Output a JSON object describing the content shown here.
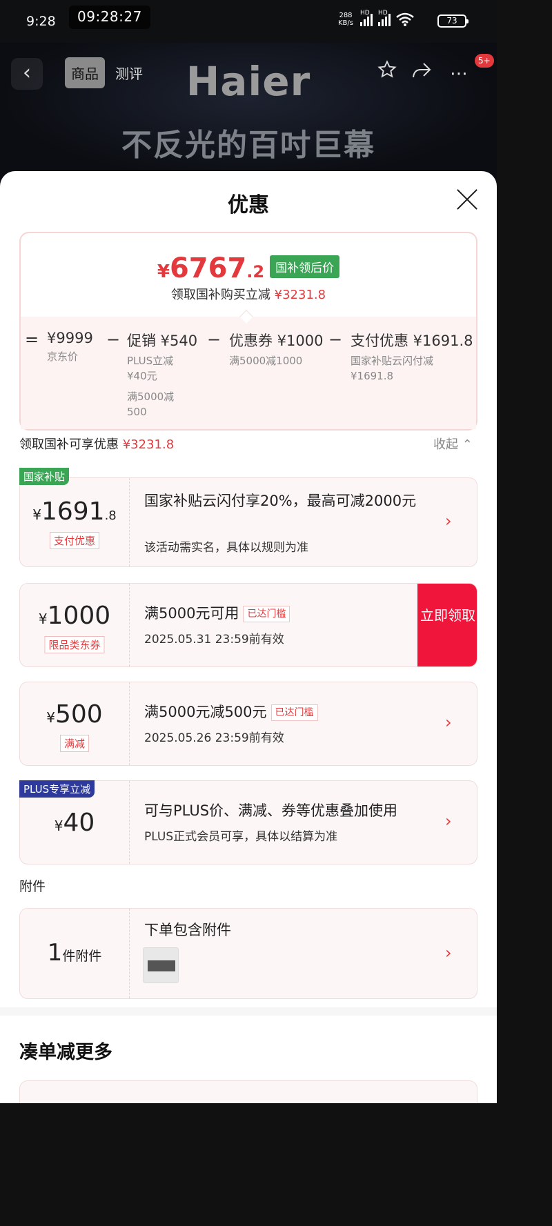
{
  "status": {
    "time": "9:28",
    "clock": "09:28:27",
    "net_speed": "288",
    "net_unit": "KB/s",
    "hd1": "HD",
    "hd2": "HD",
    "battery": "73"
  },
  "nav": {
    "back_icon": "chevron-left-icon",
    "tabs": [
      {
        "label": "商品",
        "active": true
      },
      {
        "label": "测评",
        "active": false
      }
    ],
    "badge": "5+"
  },
  "hero": {
    "brand": "Haier",
    "slogan": "不反光的百吋巨幕"
  },
  "sheet": {
    "title": "优惠",
    "final_price": {
      "yen": "¥",
      "main": "6767",
      "decimal": ".2",
      "tag": "国补领后价"
    },
    "final_sub": {
      "text": "领取国补购买立减",
      "amount": "¥3231.8"
    },
    "breakdown": [
      {
        "op": "=",
        "head": "¥9999",
        "lines": [
          "京东价"
        ]
      },
      {
        "op": "−",
        "head": "促销 ¥540",
        "lines": [
          "PLUS立减",
          "¥40元",
          "满5000减",
          "500"
        ]
      },
      {
        "op": "−",
        "head": "优惠券 ¥1000",
        "lines": [
          "满5000减1000"
        ]
      },
      {
        "op": "−",
        "head": "支付优惠 ¥1691.8",
        "lines": [
          "国家补贴云闪付减",
          "¥1691.8"
        ]
      }
    ],
    "section": {
      "label": "领取国补可享优惠",
      "amount": "¥3231.8",
      "collapse": "收起 ⌃"
    },
    "cards": {
      "subsidy": {
        "corner": "国家补贴",
        "yen": "¥",
        "main": "1691",
        "decimal": ".8",
        "tag": "支付优惠",
        "title": "国家补贴云闪付享20%，最高可减2000元",
        "sub": "该活动需实名，具体以规则为准"
      },
      "coupon": {
        "yen": "¥",
        "main": "1000",
        "tag": "限品类东券",
        "title": "满5000元可用",
        "met": "已达门槛",
        "sub": "2025.05.31 23:59前有效",
        "action": "立即领取"
      },
      "reduce": {
        "yen": "¥",
        "main": "500",
        "tag": "满减",
        "title": "满5000元减500元",
        "met": "已达门槛",
        "sub": "2025.05.26 23:59前有效"
      },
      "plus": {
        "corner": "PLUS专享立减",
        "yen": "¥",
        "main": "40",
        "title": "可与PLUS价、满减、券等优惠叠加使用",
        "sub": "PLUS正式会员可享，具体以结算为准"
      }
    },
    "accessory": {
      "section": "附件",
      "count": "1",
      "unit": "件附件",
      "title": "下单包含附件"
    },
    "more": "凑单减更多"
  },
  "colors": {
    "accent": "#e4393c",
    "green_tag": "#3aa655",
    "plus_blue": "#2d3a9c",
    "grab_red": "#f0153a"
  }
}
